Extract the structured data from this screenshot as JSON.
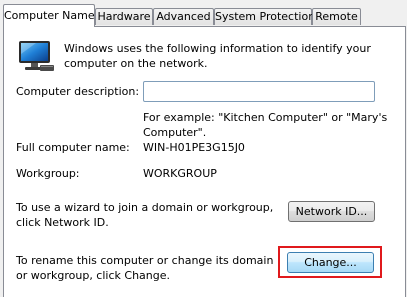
{
  "tabs": [
    {
      "label": "Computer Name"
    },
    {
      "label": "Hardware"
    },
    {
      "label": "Advanced"
    },
    {
      "label": "System Protection"
    },
    {
      "label": "Remote"
    }
  ],
  "intro": "Windows uses the following information to identify your computer on the network.",
  "computer_description": {
    "label": "Computer description:",
    "value": "",
    "hint": "For example: \"Kitchen Computer\" or \"Mary's Computer\"."
  },
  "full_computer_name": {
    "label": "Full computer name:",
    "value": "WIN-H01PE3G15J0"
  },
  "workgroup": {
    "label": "Workgroup:",
    "value": "WORKGROUP"
  },
  "network_section": {
    "text": "To use a wizard to join a domain or workgroup, click Network ID.",
    "button": "Network ID..."
  },
  "rename_section": {
    "text": "To rename this computer or change its domain or workgroup, click Change.",
    "button": "Change..."
  },
  "colors": {
    "highlight": "#e0191c",
    "tab_border": "#898c95",
    "focus_button": "#3c7fb1"
  },
  "icons": {
    "computer": "computer-monitor-icon"
  }
}
